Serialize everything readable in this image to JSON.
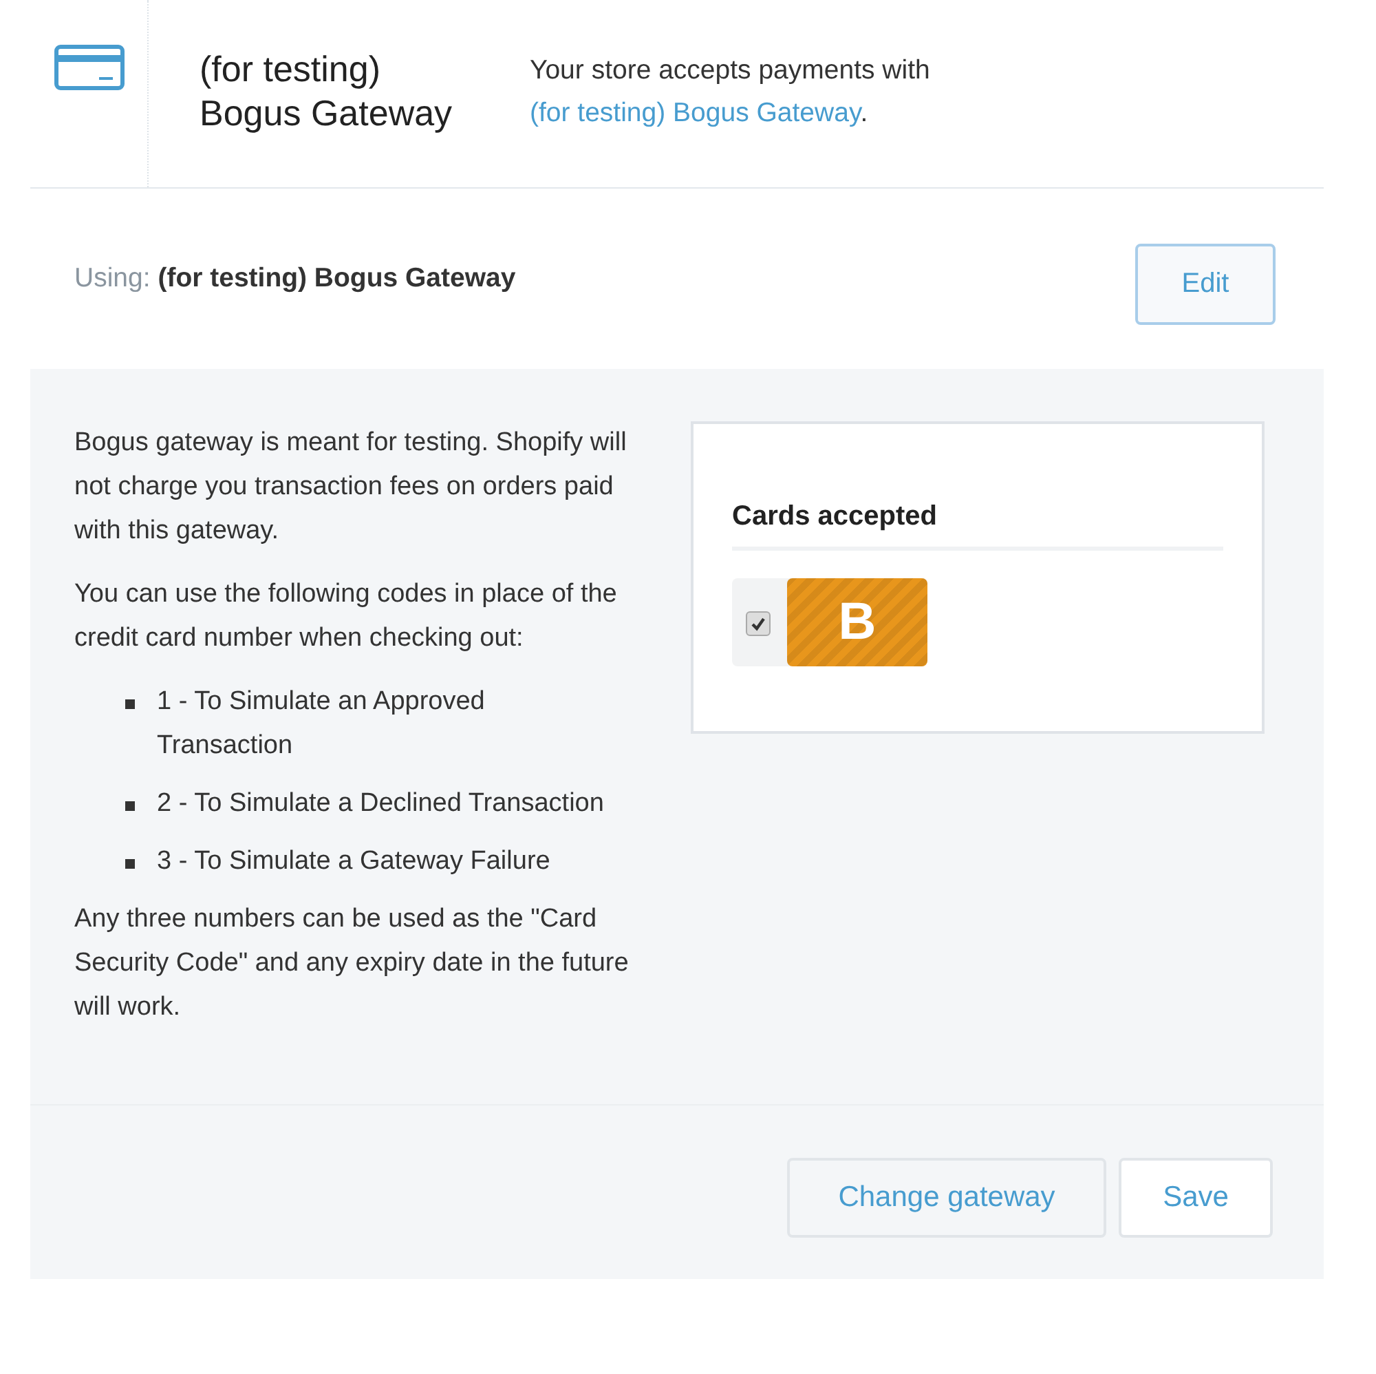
{
  "header": {
    "title": "(for testing) Bogus Gateway",
    "description": "Your store accepts payments with",
    "link": "(for testing) Bogus Gateway",
    "suffix": "."
  },
  "using": {
    "text": "Using: **(for testing) Bogus Gateway**",
    "edit_button": "Edit"
  },
  "info": {
    "paragraphs": [
      "Bogus gateway is meant for testing. Shopify will not charge you transaction fees on orders paid with this gateway.",
      "You can use the following codes in place of the credit card number when checking out:"
    ],
    "codes": [
      "1 - To Simulate an Approved Transaction",
      "2 - To Simulate a Declined Transaction",
      "3 - To Simulate a Gateway Failure"
    ],
    "closing": "Any three numbers can be used as the \"Card Security Code\" and any expiry date in the future will work."
  },
  "cards": {
    "title": "Cards accepted",
    "items": [
      {
        "letter": "B",
        "checked": true,
        "color": "#e8961c"
      }
    ]
  },
  "buttons": [
    {
      "label": "Change gateway",
      "kind": "secondary"
    },
    {
      "label": "Save",
      "kind": "primary"
    }
  ]
}
